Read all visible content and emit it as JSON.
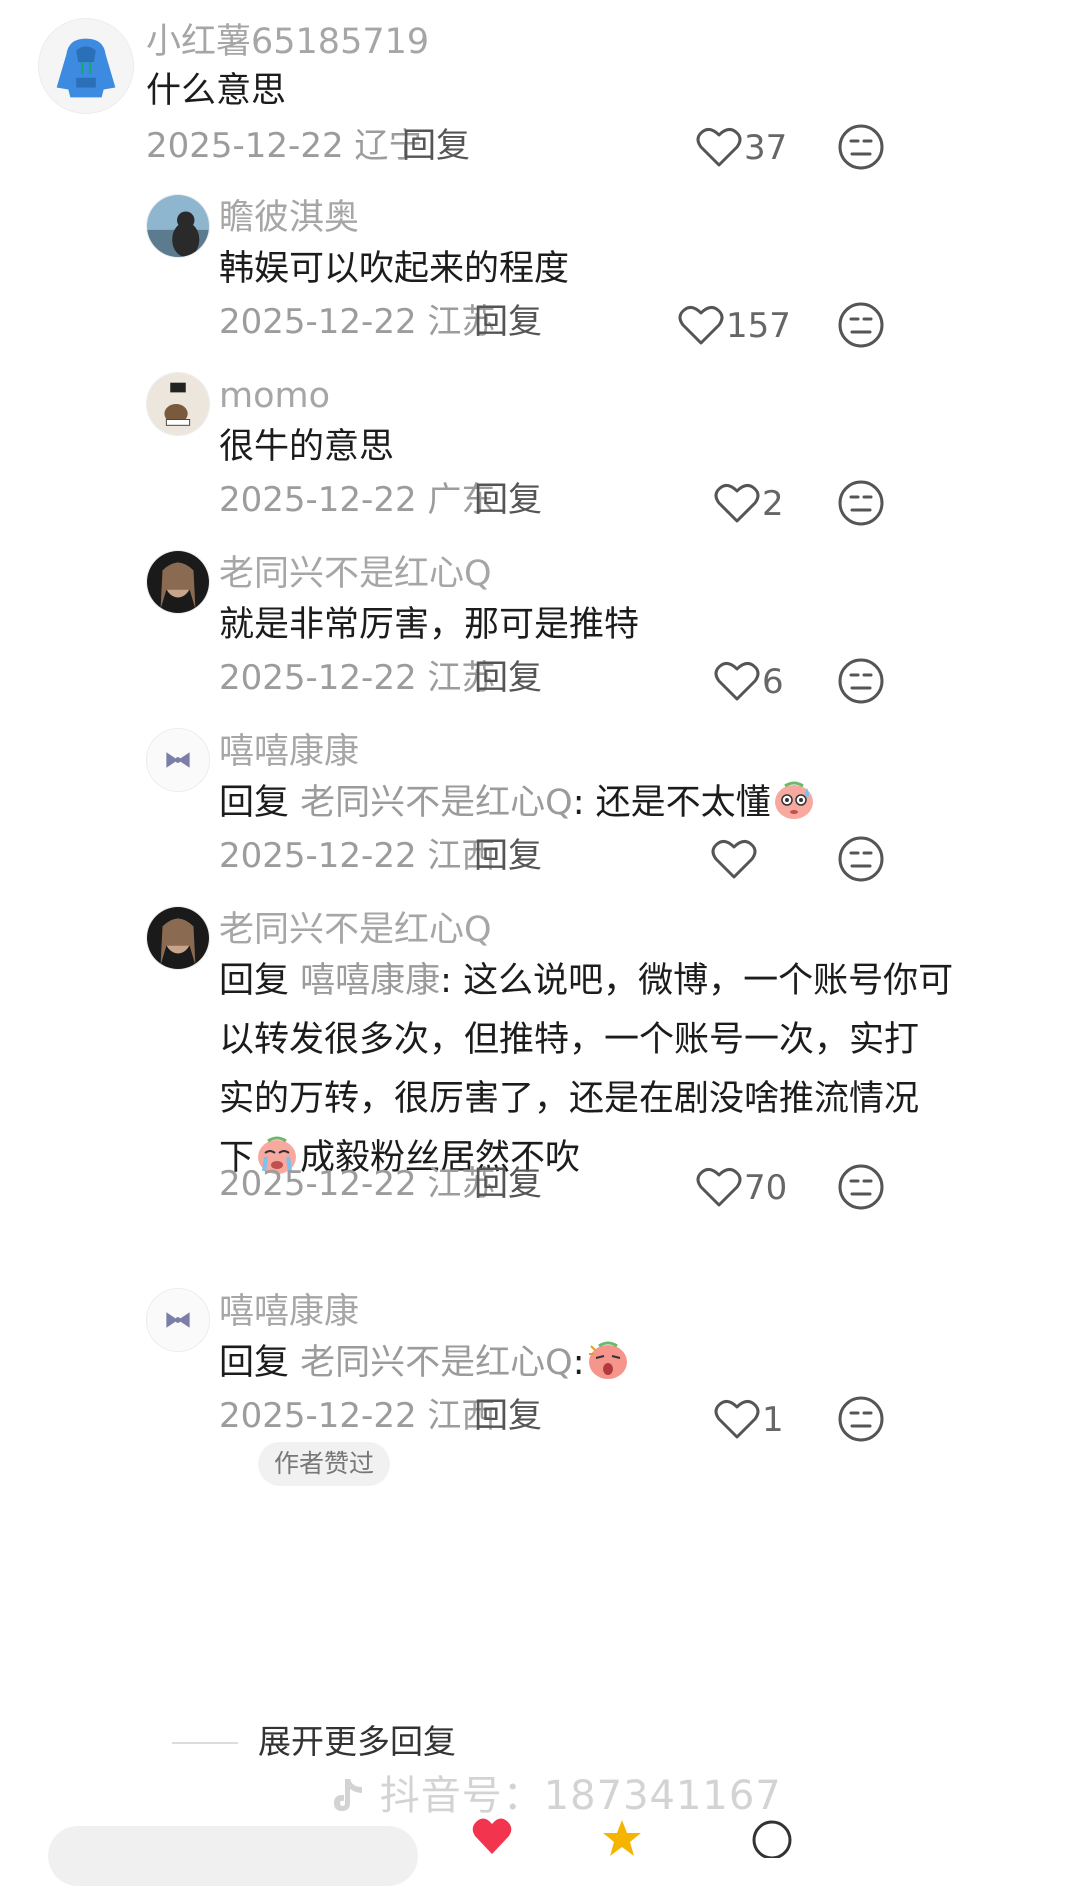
{
  "comments": [
    {
      "username": "小红薯65185719",
      "text": "什么意思",
      "date": "2025-12-22",
      "location": "辽宁",
      "reply_label": "回复",
      "likes": "37"
    },
    {
      "username": "瞻彼淇奥",
      "text": "韩娱可以吹起来的程度",
      "date": "2025-12-22",
      "location": "江苏",
      "reply_label": "回复",
      "likes": "157"
    },
    {
      "username": "momo",
      "text": "很牛的意思",
      "date": "2025-12-22",
      "location": "广东",
      "reply_label": "回复",
      "likes": "2"
    },
    {
      "username": "老同兴不是红心Q",
      "text": "就是非常厉害，那可是推特",
      "date": "2025-12-22",
      "location": "江苏",
      "reply_label": "回复",
      "likes": "6"
    },
    {
      "username": "嘻嘻康康",
      "reply_prefix": "回复",
      "reply_target": "老同兴不是红心Q",
      "text": ": 还是不太懂",
      "date": "2025-12-22",
      "location": "江西",
      "reply_label": "回复",
      "likes": ""
    },
    {
      "username": "老同兴不是红心Q",
      "reply_prefix": "回复",
      "reply_target": "嘻嘻康康",
      "text_lines": [
        ": 这么说吧，微博，一个账号你可",
        "以转发很多次，但推特，一个账号一次，实打",
        "实的万转，很厉害了，还是在剧没啥推流情况",
        "下",
        "成毅粉丝居然不吹"
      ],
      "date": "2025-12-22",
      "location": "江苏",
      "reply_label": "回复",
      "likes": "70",
      "badge": "作者赞过"
    },
    {
      "username": "嘻嘻康康",
      "reply_prefix": "回复",
      "reply_target": "老同兴不是红心Q",
      "text": ":",
      "date": "2025-12-22",
      "location": "江西",
      "reply_label": "回复",
      "likes": "1"
    }
  ],
  "expand_replies": "展开更多回复",
  "watermark": "抖音号：187341167",
  "colors": {
    "username": "#a6a6a6",
    "text": "#1c1c1c",
    "meta": "#9c9c9c",
    "reply_target": "#9b9b9b",
    "heart_red": "#f2344e"
  },
  "icons": [
    "hoodie-avatar",
    "heart-outline-icon",
    "dislike-face-icon",
    "sweat-emoji",
    "crying-emoji",
    "shocked-emoji",
    "douyin-logo"
  ]
}
